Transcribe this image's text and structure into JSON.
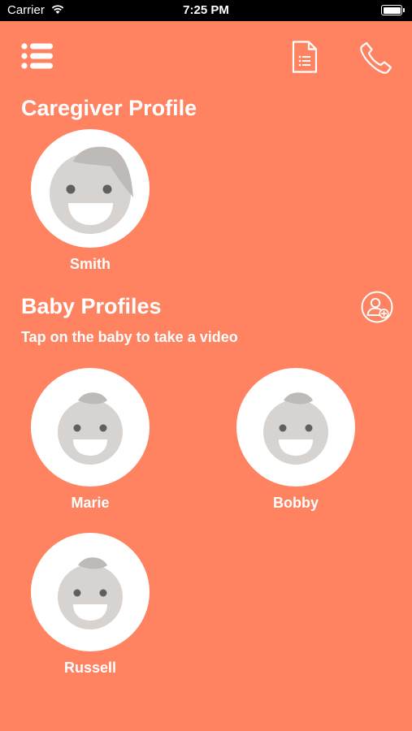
{
  "status_bar": {
    "carrier": "Carrier",
    "time": "7:25 PM"
  },
  "toolbar": {
    "menu_icon": "list-menu-icon",
    "document_icon": "document-list-icon",
    "phone_icon": "phone-icon"
  },
  "caregiver": {
    "title": "Caregiver Profile",
    "profiles": [
      {
        "name": "Smith",
        "avatar": "adult-avatar"
      }
    ]
  },
  "baby": {
    "title": "Baby Profiles",
    "subtitle": "Tap on the baby to take a video",
    "add_icon": "add-user-icon",
    "profiles": [
      {
        "name": "Marie",
        "avatar": "baby-avatar"
      },
      {
        "name": "Bobby",
        "avatar": "baby-avatar"
      },
      {
        "name": "Russell",
        "avatar": "baby-avatar"
      }
    ]
  },
  "colors": {
    "background": "#ff8360",
    "avatar_circle": "#ffffff",
    "avatar_face": "#d6d3d1",
    "avatar_hair": "#bdbab8",
    "avatar_features": "#5f5f5f"
  }
}
